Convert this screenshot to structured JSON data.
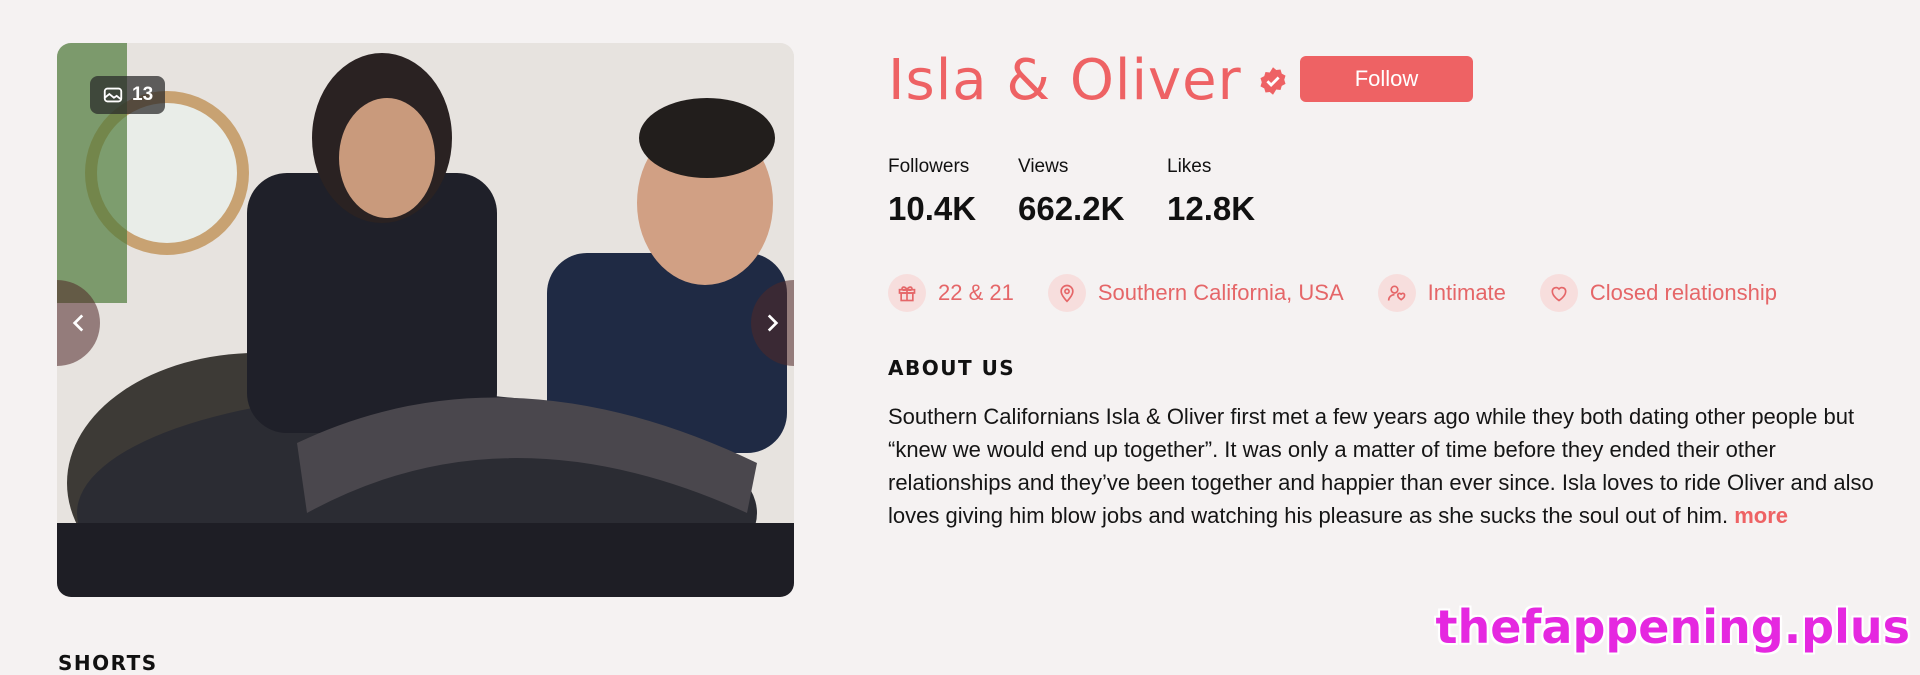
{
  "gallery": {
    "photo_count": "13",
    "prev_label": "Previous photo",
    "next_label": "Next photo"
  },
  "profile": {
    "name": "Isla & Oliver",
    "follow_label": "Follow",
    "stats": [
      {
        "label": "Followers",
        "value": "10.4K"
      },
      {
        "label": "Views",
        "value": "662.2K"
      },
      {
        "label": "Likes",
        "value": "12.8K"
      }
    ],
    "tags": [
      {
        "icon": "gift-icon",
        "text": "22 & 21"
      },
      {
        "icon": "location-pin-icon",
        "text": "Southern California, USA"
      },
      {
        "icon": "user-heart-icon",
        "text": "Intimate"
      },
      {
        "icon": "heart-icon",
        "text": "Closed relationship"
      }
    ]
  },
  "about": {
    "heading": "ABOUT US",
    "text": "Southern Californians Isla & Oliver first met a few years ago while they both dating other people but “knew we would end up together”. It was only a matter of time before they ended their other relationships and they’ve been together and happier than ever since. Isla loves to ride Oliver and also loves giving him blow jobs and watching his pleasure as she sucks the soul out of him.",
    "more_label": "more"
  },
  "shorts": {
    "heading": "SHORTS"
  },
  "watermark": "thefappening.plus",
  "colors": {
    "accent": "#ee6264",
    "background": "#f5f2f2",
    "tag_bg": "#f7dedd"
  }
}
